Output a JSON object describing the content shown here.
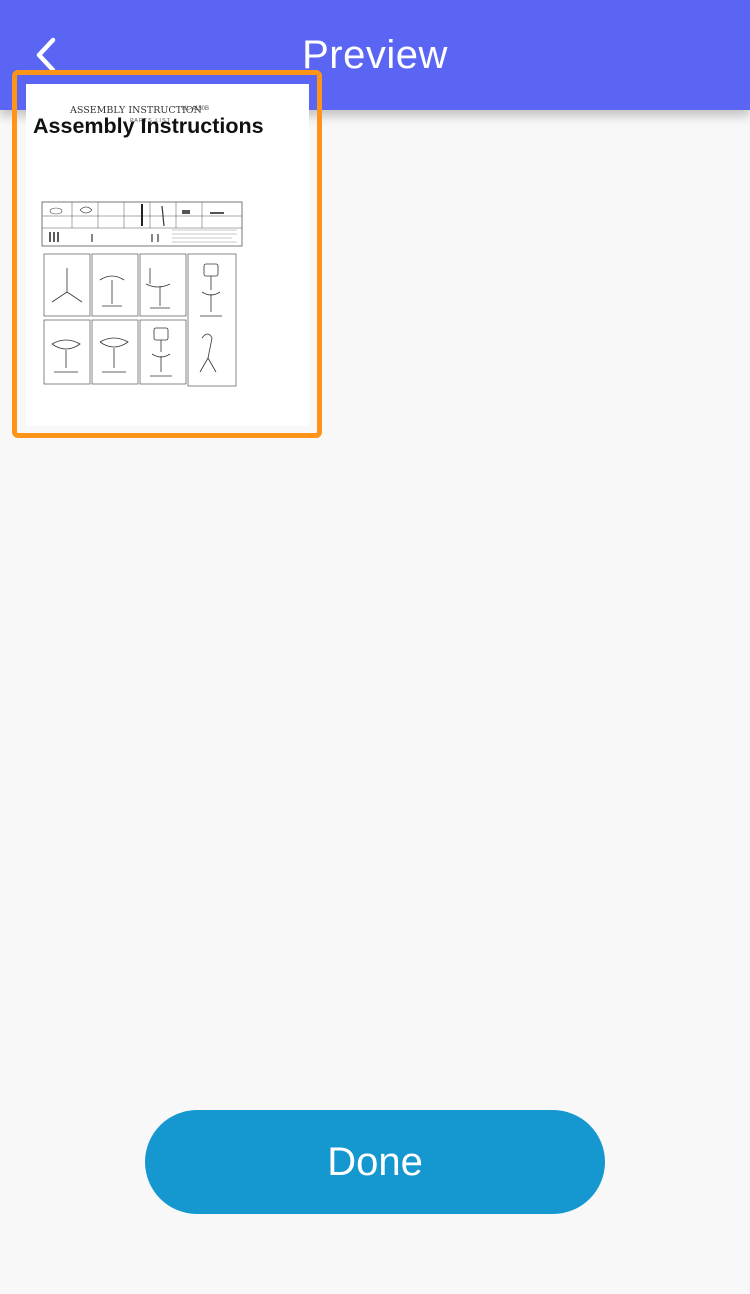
{
  "header": {
    "title": "Preview",
    "back_icon": "chevron-left-icon"
  },
  "card": {
    "title": "Assembly Instructions",
    "thumbnail": {
      "heading": "ASSEMBLY INSTRUCTION",
      "code": "HL-4150B",
      "subheading": "PARTS LIST"
    }
  },
  "footer": {
    "done_label": "Done"
  },
  "colors": {
    "header_bg": "#5b65f3",
    "highlight": "#ff9419",
    "done_bg": "#1598d0",
    "page_bg": "#f8f8f8"
  }
}
